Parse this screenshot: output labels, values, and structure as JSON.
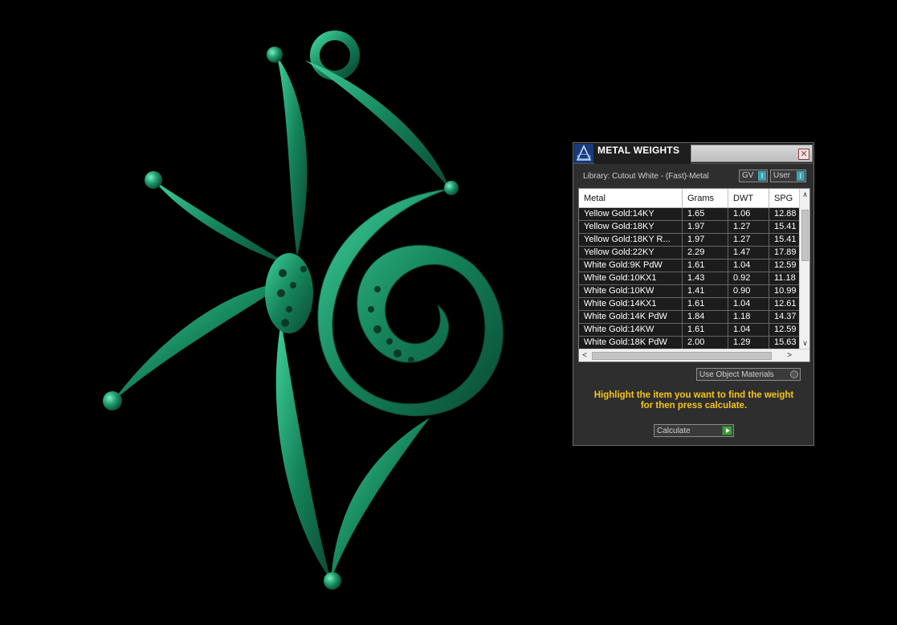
{
  "panel": {
    "title": "METAL WEIGHTS",
    "close_glyph": "✕",
    "app_icon": "rhino-gold-icon",
    "library_label": "Library: Cutout White - (Fast)-Metal",
    "toggles": {
      "gv_label": "GV",
      "gv_indicator": "I",
      "user_label": "User",
      "user_indicator": "I"
    },
    "table": {
      "headers": [
        "Metal",
        "Grams",
        "DWT",
        "SPG"
      ],
      "rows": [
        [
          "Yellow Gold:14KY",
          "1.65",
          "1.06",
          "12.88"
        ],
        [
          "Yellow Gold:18KY",
          "1.97",
          "1.27",
          "15.41"
        ],
        [
          "Yellow Gold:18KY R...",
          "1.97",
          "1.27",
          "15.41"
        ],
        [
          "Yellow Gold:22KY",
          "2.29",
          "1.47",
          "17.89"
        ],
        [
          "White Gold:9K PdW",
          "1.61",
          "1.04",
          "12.59"
        ],
        [
          "White Gold:10KX1",
          "1.43",
          "0.92",
          "11.18"
        ],
        [
          "White Gold:10KW",
          "1.41",
          "0.90",
          "10.99"
        ],
        [
          "White Gold:14KX1",
          "1.61",
          "1.04",
          "12.61"
        ],
        [
          "White Gold:14K PdW",
          "1.84",
          "1.18",
          "14.37"
        ],
        [
          "White Gold:14KW",
          "1.61",
          "1.04",
          "12.59"
        ],
        [
          "White Gold:18K PdW",
          "2.00",
          "1.29",
          "15.63"
        ]
      ],
      "scroll_up": "∧",
      "scroll_down": "∨",
      "scroll_left": "<",
      "scroll_right": ">"
    },
    "use_object_materials_label": "Use Object Materials",
    "instructions_line1": "Highlight the item you want to find the weight",
    "instructions_line2": "for then press calculate.",
    "calculate_label": "Calculate"
  },
  "viewport": {
    "model_color": "#1f9a6c",
    "background": "#000000"
  }
}
